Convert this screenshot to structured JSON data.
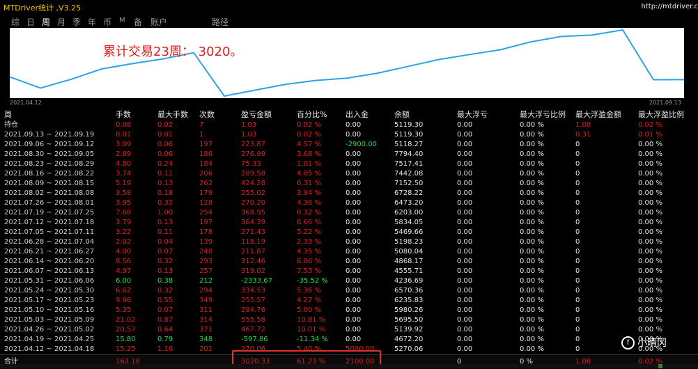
{
  "app": {
    "title": "MTDriver统计 ,V3.25",
    "url": "http://mtdriver.c"
  },
  "tabs": [
    {
      "label": "综",
      "active": false
    },
    {
      "label": "日",
      "active": false
    },
    {
      "label": "周",
      "active": true
    },
    {
      "label": "月",
      "active": false
    },
    {
      "label": "季",
      "active": false
    },
    {
      "label": "年",
      "active": false
    },
    {
      "label": "币",
      "active": false
    },
    {
      "label": "M",
      "active": false
    },
    {
      "label": "备",
      "active": false
    },
    {
      "label": "账户",
      "active": false
    },
    {
      "label": "路径",
      "active": false
    }
  ],
  "chart_data": {
    "type": "line",
    "title": "累计交易23周： 3020。",
    "start_label": "2021.04.12",
    "end_label": "2021.09.13",
    "x": [
      "2021.04.12",
      "2021.04.19",
      "2021.04.26",
      "2021.05.03",
      "2021.05.10",
      "2021.05.17",
      "2021.05.24",
      "2021.05.31",
      "2021.06.07",
      "2021.06.14",
      "2021.06.21",
      "2021.06.28",
      "2021.07.05",
      "2021.07.12",
      "2021.07.19",
      "2021.07.26",
      "2021.08.02",
      "2021.08.09",
      "2021.08.16",
      "2021.08.23",
      "2021.08.30",
      "2021.09.06",
      "2021.09.13"
    ],
    "series": [
      {
        "values": [
          5270.06,
          4672.2,
          5139.92,
          5695.5,
          5980.26,
          6235.83,
          6570.36,
          4236.69,
          4555.71,
          4868.17,
          5080.04,
          5198.23,
          5469.66,
          5834.05,
          6203.0,
          6473.2,
          6728.22,
          7152.5,
          7442.08,
          7517.41,
          7794.4,
          5118.27,
          5119.3
        ]
      }
    ],
    "line_color": "#2aa3e8",
    "grid": false
  },
  "table": {
    "headers": [
      "周",
      "手数",
      "最大手数",
      "次数",
      "盈亏金额",
      "百分比%",
      "出入金",
      "余额",
      "最大浮亏",
      "最大浮亏比例",
      "最大浮盈金额",
      "最大浮盈比例"
    ],
    "rows": [
      {
        "week": "持仓",
        "lots": "0.08",
        "max_lots": "0.02",
        "count": "7",
        "pnl": "1.03",
        "pct": "0.02 %",
        "flow": "0.00",
        "balance": "5119.30",
        "max_dd": "0.00",
        "max_dd_pct": "0.00 %",
        "max_fp": "1.08",
        "max_fp_pct": "0.02 %",
        "tone": "red",
        "fp_tone": "red"
      },
      {
        "week": "2021.09.13 ~ 2021.09.19",
        "lots": "0.01",
        "max_lots": "0.01",
        "count": "1",
        "pnl": "1.03",
        "pct": "0.02 %",
        "flow": "0.00",
        "balance": "5119.30",
        "max_dd": "0.00",
        "max_dd_pct": "0.00 %",
        "max_fp": "0.31",
        "max_fp_pct": "0.01 %",
        "tone": "red",
        "fp_tone": "red"
      },
      {
        "week": "2021.09.06 ~ 2021.09.12",
        "lots": "3.09",
        "max_lots": "0.06",
        "count": "197",
        "pnl": "223.87",
        "pct": "4.57 %",
        "flow": "-2900.00",
        "balance": "5118.27",
        "max_dd": "0.00",
        "max_dd_pct": "0.00 %",
        "max_fp": "0",
        "max_fp_pct": "0.00 %",
        "tone": "red",
        "fp_tone": "white",
        "flow_tone": "green"
      },
      {
        "week": "2021.08.30 ~ 2021.09.05",
        "lots": "2.89",
        "max_lots": "0.06",
        "count": "186",
        "pnl": "276.99",
        "pct": "3.68 %",
        "flow": "0.00",
        "balance": "7794.40",
        "max_dd": "0.00",
        "max_dd_pct": "0.00 %",
        "max_fp": "0",
        "max_fp_pct": "0.00 %",
        "tone": "red",
        "fp_tone": "white"
      },
      {
        "week": "2021.08.23 ~ 2021.08.29",
        "lots": "4.80",
        "max_lots": "0.24",
        "count": "184",
        "pnl": "75.33",
        "pct": "1.01 %",
        "flow": "0.00",
        "balance": "7517.41",
        "max_dd": "0.00",
        "max_dd_pct": "0.00 %",
        "max_fp": "0",
        "max_fp_pct": "0.00 %",
        "tone": "red",
        "fp_tone": "white"
      },
      {
        "week": "2021.08.16 ~ 2021.08.22",
        "lots": "3.74",
        "max_lots": "0.11",
        "count": "206",
        "pnl": "289.58",
        "pct": "4.05 %",
        "flow": "0.00",
        "balance": "7442.08",
        "max_dd": "0.00",
        "max_dd_pct": "0.00 %",
        "max_fp": "0",
        "max_fp_pct": "0.00 %",
        "tone": "red",
        "fp_tone": "white"
      },
      {
        "week": "2021.08.09 ~ 2021.08.15",
        "lots": "5.19",
        "max_lots": "0.13",
        "count": "262",
        "pnl": "424.28",
        "pct": "6.31 %",
        "flow": "0.00",
        "balance": "7152.50",
        "max_dd": "0.00",
        "max_dd_pct": "0.00 %",
        "max_fp": "0",
        "max_fp_pct": "0.00 %",
        "tone": "red",
        "fp_tone": "white"
      },
      {
        "week": "2021.08.02 ~ 2021.08.08",
        "lots": "3.58",
        "max_lots": "0.18",
        "count": "179",
        "pnl": "255.02",
        "pct": "3.94 %",
        "flow": "0.00",
        "balance": "6728.22",
        "max_dd": "0.00",
        "max_dd_pct": "0.00 %",
        "max_fp": "0",
        "max_fp_pct": "0.00 %",
        "tone": "red",
        "fp_tone": "white"
      },
      {
        "week": "2021.07.26 ~ 2021.08.01",
        "lots": "3.95",
        "max_lots": "0.32",
        "count": "128",
        "pnl": "270.20",
        "pct": "4.36 %",
        "flow": "0.00",
        "balance": "6473.20",
        "max_dd": "0.00",
        "max_dd_pct": "0.00 %",
        "max_fp": "0",
        "max_fp_pct": "0.00 %",
        "tone": "red",
        "fp_tone": "white"
      },
      {
        "week": "2021.07.19 ~ 2021.07.25",
        "lots": "7.68",
        "max_lots": "1.00",
        "count": "254",
        "pnl": "368.95",
        "pct": "6.32 %",
        "flow": "0.00",
        "balance": "6203.00",
        "max_dd": "0.00",
        "max_dd_pct": "0.00 %",
        "max_fp": "0",
        "max_fp_pct": "0.00 %",
        "tone": "red",
        "fp_tone": "white"
      },
      {
        "week": "2021.07.12 ~ 2021.07.18",
        "lots": "3.79",
        "max_lots": "0.13",
        "count": "197",
        "pnl": "364.39",
        "pct": "6.66 %",
        "flow": "0.00",
        "balance": "5834.05",
        "max_dd": "0.00",
        "max_dd_pct": "0.00 %",
        "max_fp": "0",
        "max_fp_pct": "0.00 %",
        "tone": "red",
        "fp_tone": "white"
      },
      {
        "week": "2021.07.05 ~ 2021.07.11",
        "lots": "3.22",
        "max_lots": "0.11",
        "count": "178",
        "pnl": "271.43",
        "pct": "5.22 %",
        "flow": "0.00",
        "balance": "5469.66",
        "max_dd": "0.00",
        "max_dd_pct": "0.00 %",
        "max_fp": "0",
        "max_fp_pct": "0.00 %",
        "tone": "red",
        "fp_tone": "white"
      },
      {
        "week": "2021.06.28 ~ 2021.07.04",
        "lots": "2.02",
        "max_lots": "0.04",
        "count": "139",
        "pnl": "118.19",
        "pct": "2.33 %",
        "flow": "0.00",
        "balance": "5198.23",
        "max_dd": "0.00",
        "max_dd_pct": "0.00 %",
        "max_fp": "0",
        "max_fp_pct": "0.00 %",
        "tone": "red",
        "fp_tone": "white"
      },
      {
        "week": "2021.06.21 ~ 2021.06.27",
        "lots": "4.00",
        "max_lots": "0.07",
        "count": "248",
        "pnl": "211.87",
        "pct": "4.35 %",
        "flow": "0.00",
        "balance": "5080.04",
        "max_dd": "0.00",
        "max_dd_pct": "0.00 %",
        "max_fp": "0",
        "max_fp_pct": "0.00 %",
        "tone": "red",
        "fp_tone": "white"
      },
      {
        "week": "2021.06.14 ~ 2021.06.20",
        "lots": "8.56",
        "max_lots": "0.32",
        "count": "293",
        "pnl": "312.46",
        "pct": "6.86 %",
        "flow": "0.00",
        "balance": "4868.17",
        "max_dd": "0.00",
        "max_dd_pct": "0.00 %",
        "max_fp": "0",
        "max_fp_pct": "0.00 %",
        "tone": "red",
        "fp_tone": "white"
      },
      {
        "week": "2021.06.07 ~ 2021.06.13",
        "lots": "4.97",
        "max_lots": "0.13",
        "count": "257",
        "pnl": "319.02",
        "pct": "7.53 %",
        "flow": "0.00",
        "balance": "4555.71",
        "max_dd": "0.00",
        "max_dd_pct": "0.00 %",
        "max_fp": "0",
        "max_fp_pct": "0.00 %",
        "tone": "red",
        "fp_tone": "white"
      },
      {
        "week": "2021.05.31 ~ 2021.06.06",
        "lots": "6.00",
        "max_lots": "0.38",
        "count": "212",
        "pnl": "-2333.67",
        "pct": "-35.52 %",
        "flow": "0.00",
        "balance": "4236.69",
        "max_dd": "0.00",
        "max_dd_pct": "0.00 %",
        "max_fp": "0",
        "max_fp_pct": "0.00 %",
        "tone": "green",
        "fp_tone": "white"
      },
      {
        "week": "2021.05.24 ~ 2021.05.30",
        "lots": "6.62",
        "max_lots": "0.32",
        "count": "294",
        "pnl": "334.53",
        "pct": "5.36 %",
        "flow": "0.00",
        "balance": "6570.36",
        "max_dd": "0.00",
        "max_dd_pct": "0.00 %",
        "max_fp": "0",
        "max_fp_pct": "0.00 %",
        "tone": "red",
        "fp_tone": "white"
      },
      {
        "week": "2021.05.17 ~ 2021.05.23",
        "lots": "9.98",
        "max_lots": "0.55",
        "count": "349",
        "pnl": "255.57",
        "pct": "4.27 %",
        "flow": "0.00",
        "balance": "6235.83",
        "max_dd": "0.00",
        "max_dd_pct": "0.00 %",
        "max_fp": "0",
        "max_fp_pct": "0.00 %",
        "tone": "red",
        "fp_tone": "white"
      },
      {
        "week": "2021.05.10 ~ 2021.05.16",
        "lots": "5.35",
        "max_lots": "0.07",
        "count": "311",
        "pnl": "284.76",
        "pct": "5.00 %",
        "flow": "0.00",
        "balance": "5980.26",
        "max_dd": "0.00",
        "max_dd_pct": "0.00 %",
        "max_fp": "0",
        "max_fp_pct": "0.00 %",
        "tone": "red",
        "fp_tone": "white"
      },
      {
        "week": "2021.05.03 ~ 2021.05.09",
        "lots": "21.02",
        "max_lots": "0.87",
        "count": "314",
        "pnl": "555.58",
        "pct": "10.81 %",
        "flow": "0.00",
        "balance": "5695.50",
        "max_dd": "0.00",
        "max_dd_pct": "0.00 %",
        "max_fp": "0",
        "max_fp_pct": "0.00 %",
        "tone": "red",
        "fp_tone": "white"
      },
      {
        "week": "2021.04.26 ~ 2021.05.02",
        "lots": "20.57",
        "max_lots": "0.64",
        "count": "371",
        "pnl": "467.72",
        "pct": "10.01 %",
        "flow": "0.00",
        "balance": "5139.92",
        "max_dd": "0.00",
        "max_dd_pct": "0.00 %",
        "max_fp": "0",
        "max_fp_pct": "0.00 %",
        "tone": "red",
        "fp_tone": "white"
      },
      {
        "week": "2021.04.19 ~ 2021.04.25",
        "lots": "15.80",
        "max_lots": "0.79",
        "count": "348",
        "pnl": "-597.86",
        "pct": "-11.34 %",
        "flow": "0.00",
        "balance": "4672.20",
        "max_dd": "0.00",
        "max_dd_pct": "0.00 %",
        "max_fp": "0",
        "max_fp_pct": "0.00 %",
        "tone": "green",
        "fp_tone": "white"
      },
      {
        "week": "2021.04.12 ~ 2021.04.18",
        "lots": "15.25",
        "max_lots": "1.16",
        "count": "201",
        "pnl": "270.06",
        "pct": "5.40 %",
        "flow": "5000.00",
        "balance": "5270.06",
        "max_dd": "0.00",
        "max_dd_pct": "0.00 %",
        "max_fp": "0",
        "max_fp_pct": "0.00 %",
        "tone": "red",
        "fp_tone": "white",
        "flow_tone": "red"
      }
    ],
    "total": {
      "label": "合计",
      "lots": "162.18",
      "pnl": "3020.33",
      "pct": "61.23 %",
      "flow": "2100.00",
      "max_dd": "0",
      "max_dd_pct": "0 %",
      "max_fp": "1.08",
      "max_fp_pct": "0.02 %"
    }
  },
  "watermark": {
    "icon": "f",
    "text": "小晴冈"
  }
}
